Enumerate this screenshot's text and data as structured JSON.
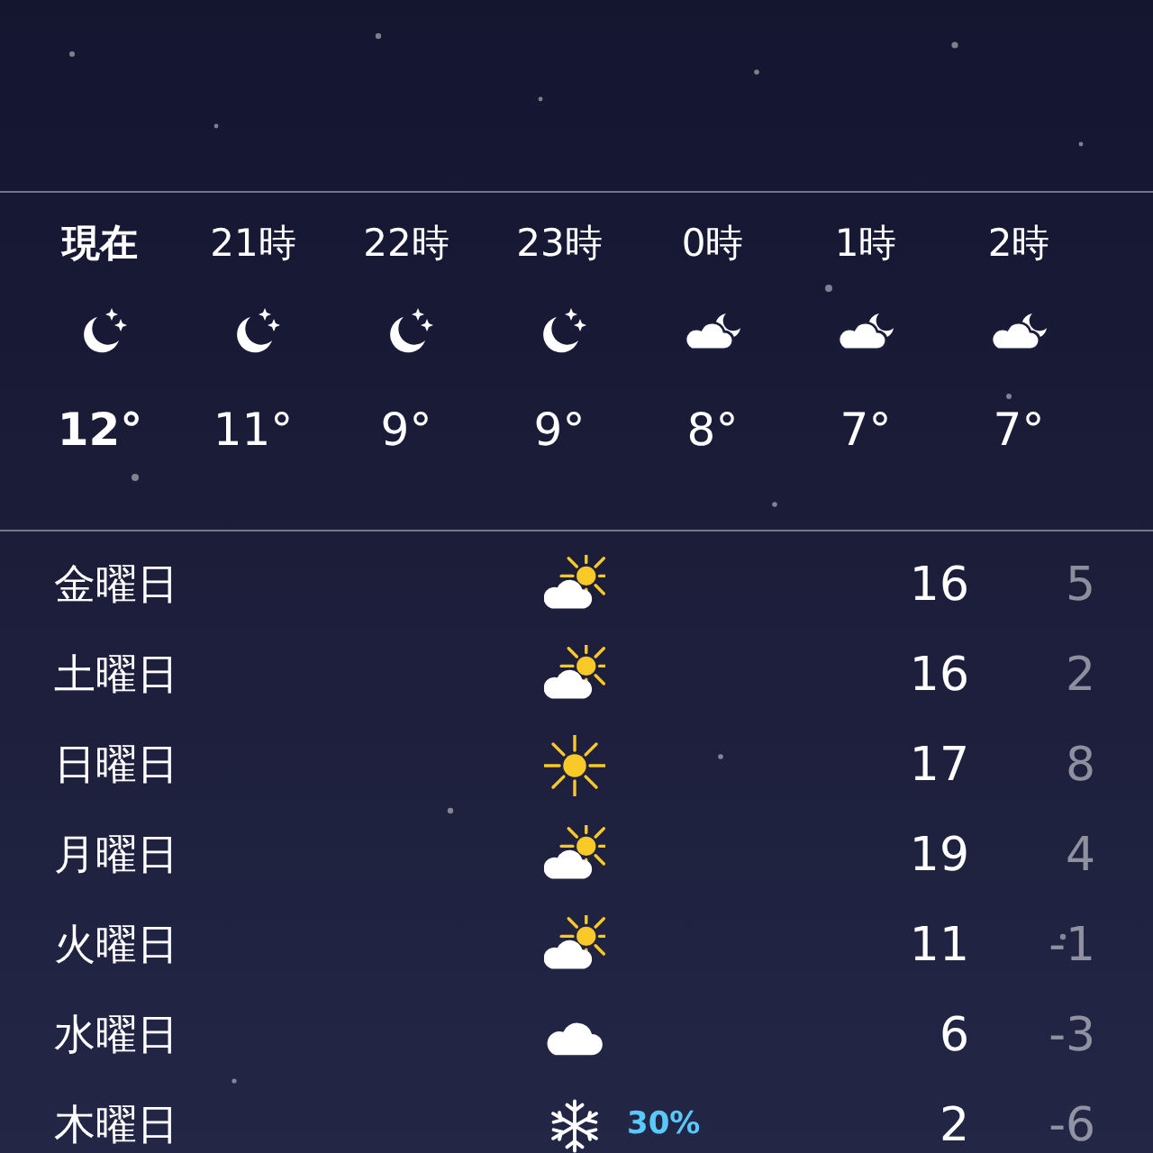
{
  "hourly": [
    {
      "time": "現在",
      "kind": "moon",
      "temp": "12°",
      "now": true
    },
    {
      "time": "21時",
      "kind": "moon",
      "temp": "11°",
      "now": false
    },
    {
      "time": "22時",
      "kind": "moon",
      "temp": "9°",
      "now": false
    },
    {
      "time": "23時",
      "kind": "moon",
      "temp": "9°",
      "now": false
    },
    {
      "time": "0時",
      "kind": "cloudmoon",
      "temp": "8°",
      "now": false
    },
    {
      "time": "1時",
      "kind": "cloudmoon",
      "temp": "7°",
      "now": false
    },
    {
      "time": "2時",
      "kind": "cloudmoon",
      "temp": "7°",
      "now": false
    }
  ],
  "daily": [
    {
      "day": "金曜日",
      "kind": "partly",
      "high": "16",
      "low": "5"
    },
    {
      "day": "土曜日",
      "kind": "partly",
      "high": "16",
      "low": "2"
    },
    {
      "day": "日曜日",
      "kind": "sunny",
      "high": "17",
      "low": "8"
    },
    {
      "day": "月曜日",
      "kind": "partly",
      "high": "19",
      "low": "4"
    },
    {
      "day": "火曜日",
      "kind": "partly",
      "high": "11",
      "low": "-1"
    },
    {
      "day": "水曜日",
      "kind": "cloudy",
      "high": "6",
      "low": "-3"
    },
    {
      "day": "木曜日",
      "kind": "snow",
      "precip": "30%",
      "high": "2",
      "low": "-6"
    }
  ]
}
